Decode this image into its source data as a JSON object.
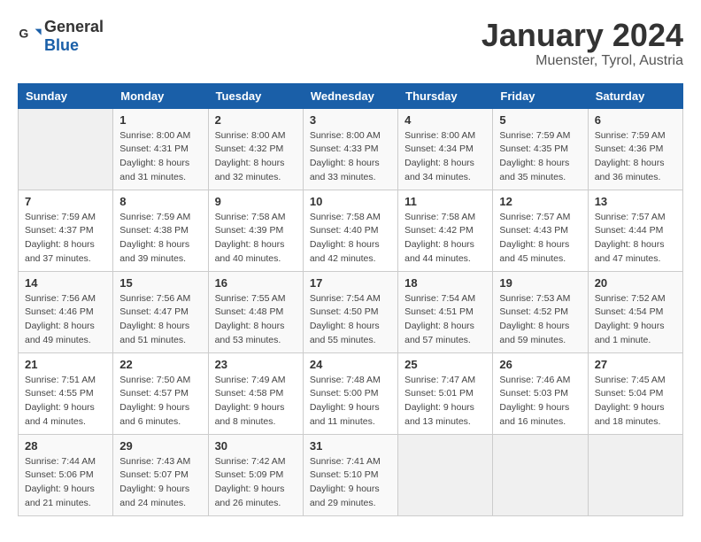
{
  "header": {
    "logo_general": "General",
    "logo_blue": "Blue",
    "title": "January 2024",
    "subtitle": "Muenster, Tyrol, Austria"
  },
  "days_of_week": [
    "Sunday",
    "Monday",
    "Tuesday",
    "Wednesday",
    "Thursday",
    "Friday",
    "Saturday"
  ],
  "weeks": [
    [
      {
        "day": "",
        "sunrise": "",
        "sunset": "",
        "daylight": ""
      },
      {
        "day": "1",
        "sunrise": "Sunrise: 8:00 AM",
        "sunset": "Sunset: 4:31 PM",
        "daylight": "Daylight: 8 hours and 31 minutes."
      },
      {
        "day": "2",
        "sunrise": "Sunrise: 8:00 AM",
        "sunset": "Sunset: 4:32 PM",
        "daylight": "Daylight: 8 hours and 32 minutes."
      },
      {
        "day": "3",
        "sunrise": "Sunrise: 8:00 AM",
        "sunset": "Sunset: 4:33 PM",
        "daylight": "Daylight: 8 hours and 33 minutes."
      },
      {
        "day": "4",
        "sunrise": "Sunrise: 8:00 AM",
        "sunset": "Sunset: 4:34 PM",
        "daylight": "Daylight: 8 hours and 34 minutes."
      },
      {
        "day": "5",
        "sunrise": "Sunrise: 7:59 AM",
        "sunset": "Sunset: 4:35 PM",
        "daylight": "Daylight: 8 hours and 35 minutes."
      },
      {
        "day": "6",
        "sunrise": "Sunrise: 7:59 AM",
        "sunset": "Sunset: 4:36 PM",
        "daylight": "Daylight: 8 hours and 36 minutes."
      }
    ],
    [
      {
        "day": "7",
        "sunrise": "Sunrise: 7:59 AM",
        "sunset": "Sunset: 4:37 PM",
        "daylight": "Daylight: 8 hours and 37 minutes."
      },
      {
        "day": "8",
        "sunrise": "Sunrise: 7:59 AM",
        "sunset": "Sunset: 4:38 PM",
        "daylight": "Daylight: 8 hours and 39 minutes."
      },
      {
        "day": "9",
        "sunrise": "Sunrise: 7:58 AM",
        "sunset": "Sunset: 4:39 PM",
        "daylight": "Daylight: 8 hours and 40 minutes."
      },
      {
        "day": "10",
        "sunrise": "Sunrise: 7:58 AM",
        "sunset": "Sunset: 4:40 PM",
        "daylight": "Daylight: 8 hours and 42 minutes."
      },
      {
        "day": "11",
        "sunrise": "Sunrise: 7:58 AM",
        "sunset": "Sunset: 4:42 PM",
        "daylight": "Daylight: 8 hours and 44 minutes."
      },
      {
        "day": "12",
        "sunrise": "Sunrise: 7:57 AM",
        "sunset": "Sunset: 4:43 PM",
        "daylight": "Daylight: 8 hours and 45 minutes."
      },
      {
        "day": "13",
        "sunrise": "Sunrise: 7:57 AM",
        "sunset": "Sunset: 4:44 PM",
        "daylight": "Daylight: 8 hours and 47 minutes."
      }
    ],
    [
      {
        "day": "14",
        "sunrise": "Sunrise: 7:56 AM",
        "sunset": "Sunset: 4:46 PM",
        "daylight": "Daylight: 8 hours and 49 minutes."
      },
      {
        "day": "15",
        "sunrise": "Sunrise: 7:56 AM",
        "sunset": "Sunset: 4:47 PM",
        "daylight": "Daylight: 8 hours and 51 minutes."
      },
      {
        "day": "16",
        "sunrise": "Sunrise: 7:55 AM",
        "sunset": "Sunset: 4:48 PM",
        "daylight": "Daylight: 8 hours and 53 minutes."
      },
      {
        "day": "17",
        "sunrise": "Sunrise: 7:54 AM",
        "sunset": "Sunset: 4:50 PM",
        "daylight": "Daylight: 8 hours and 55 minutes."
      },
      {
        "day": "18",
        "sunrise": "Sunrise: 7:54 AM",
        "sunset": "Sunset: 4:51 PM",
        "daylight": "Daylight: 8 hours and 57 minutes."
      },
      {
        "day": "19",
        "sunrise": "Sunrise: 7:53 AM",
        "sunset": "Sunset: 4:52 PM",
        "daylight": "Daylight: 8 hours and 59 minutes."
      },
      {
        "day": "20",
        "sunrise": "Sunrise: 7:52 AM",
        "sunset": "Sunset: 4:54 PM",
        "daylight": "Daylight: 9 hours and 1 minute."
      }
    ],
    [
      {
        "day": "21",
        "sunrise": "Sunrise: 7:51 AM",
        "sunset": "Sunset: 4:55 PM",
        "daylight": "Daylight: 9 hours and 4 minutes."
      },
      {
        "day": "22",
        "sunrise": "Sunrise: 7:50 AM",
        "sunset": "Sunset: 4:57 PM",
        "daylight": "Daylight: 9 hours and 6 minutes."
      },
      {
        "day": "23",
        "sunrise": "Sunrise: 7:49 AM",
        "sunset": "Sunset: 4:58 PM",
        "daylight": "Daylight: 9 hours and 8 minutes."
      },
      {
        "day": "24",
        "sunrise": "Sunrise: 7:48 AM",
        "sunset": "Sunset: 5:00 PM",
        "daylight": "Daylight: 9 hours and 11 minutes."
      },
      {
        "day": "25",
        "sunrise": "Sunrise: 7:47 AM",
        "sunset": "Sunset: 5:01 PM",
        "daylight": "Daylight: 9 hours and 13 minutes."
      },
      {
        "day": "26",
        "sunrise": "Sunrise: 7:46 AM",
        "sunset": "Sunset: 5:03 PM",
        "daylight": "Daylight: 9 hours and 16 minutes."
      },
      {
        "day": "27",
        "sunrise": "Sunrise: 7:45 AM",
        "sunset": "Sunset: 5:04 PM",
        "daylight": "Daylight: 9 hours and 18 minutes."
      }
    ],
    [
      {
        "day": "28",
        "sunrise": "Sunrise: 7:44 AM",
        "sunset": "Sunset: 5:06 PM",
        "daylight": "Daylight: 9 hours and 21 minutes."
      },
      {
        "day": "29",
        "sunrise": "Sunrise: 7:43 AM",
        "sunset": "Sunset: 5:07 PM",
        "daylight": "Daylight: 9 hours and 24 minutes."
      },
      {
        "day": "30",
        "sunrise": "Sunrise: 7:42 AM",
        "sunset": "Sunset: 5:09 PM",
        "daylight": "Daylight: 9 hours and 26 minutes."
      },
      {
        "day": "31",
        "sunrise": "Sunrise: 7:41 AM",
        "sunset": "Sunset: 5:10 PM",
        "daylight": "Daylight: 9 hours and 29 minutes."
      },
      {
        "day": "",
        "sunrise": "",
        "sunset": "",
        "daylight": ""
      },
      {
        "day": "",
        "sunrise": "",
        "sunset": "",
        "daylight": ""
      },
      {
        "day": "",
        "sunrise": "",
        "sunset": "",
        "daylight": ""
      }
    ]
  ]
}
